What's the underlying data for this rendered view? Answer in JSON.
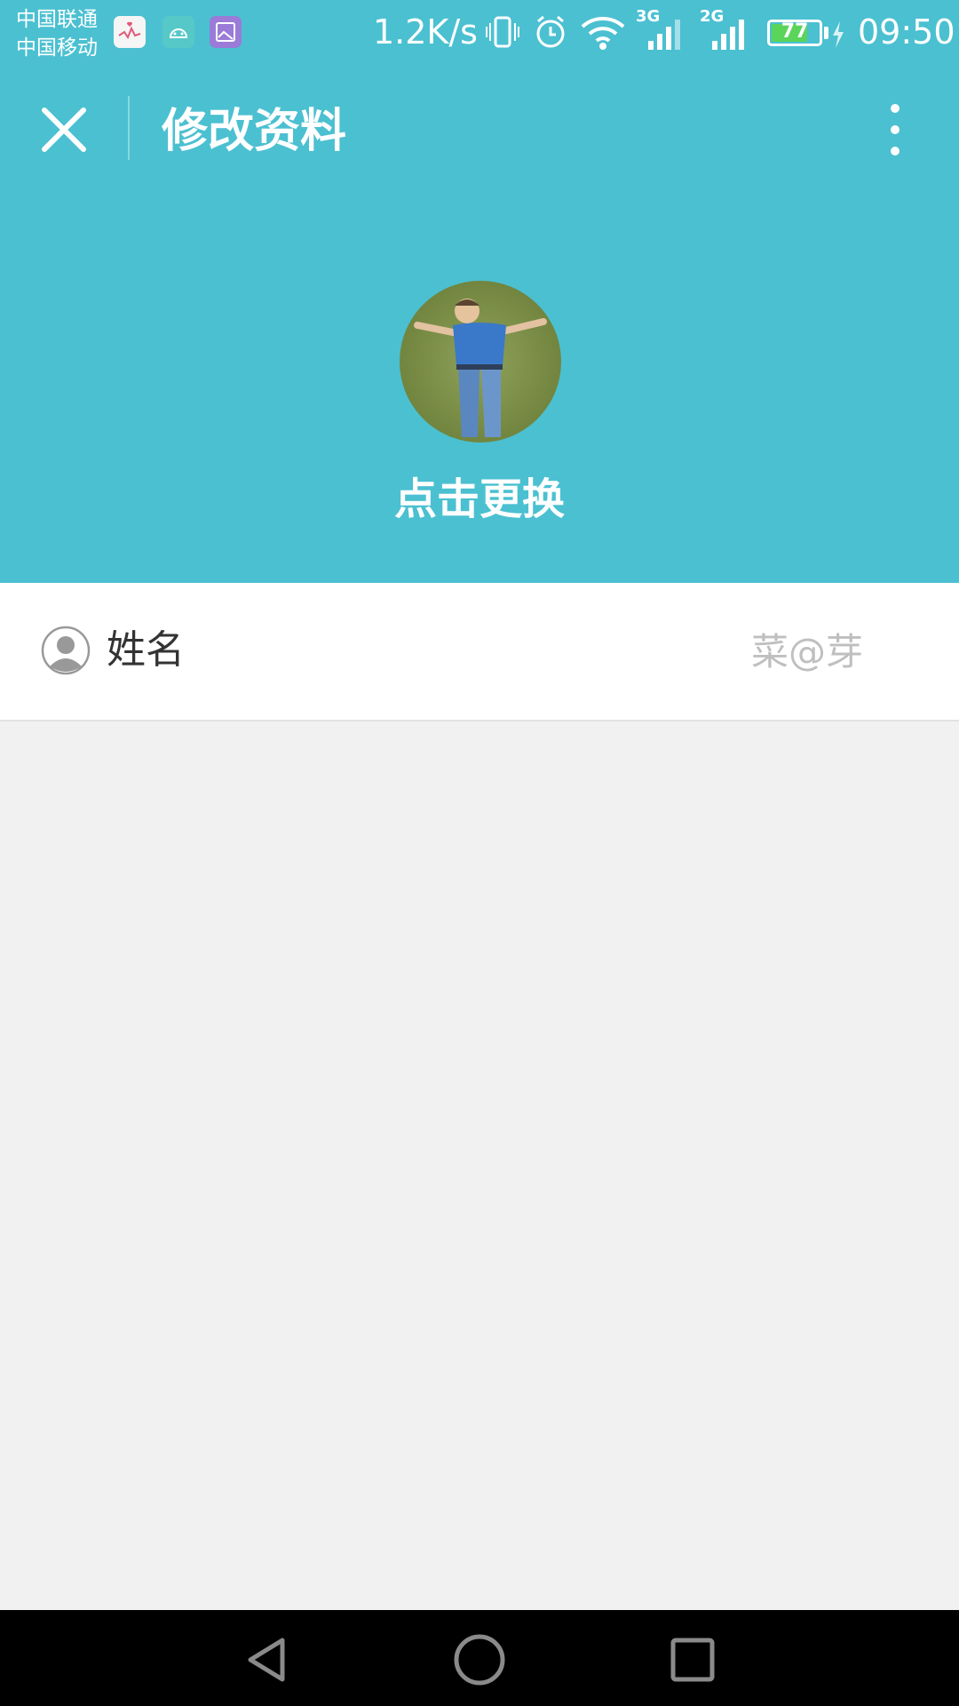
{
  "status_bar": {
    "carrier1": "中国联通",
    "carrier2": "中国移动",
    "net_speed": "1.2K/s",
    "sig1_label": "3G",
    "sig2_label": "2G",
    "battery": "77",
    "battery_level": 0.77,
    "time": "09:50"
  },
  "header": {
    "title": "修改资料",
    "change_avatar_label": "点击更换"
  },
  "profile": {
    "name_label": "姓名",
    "name_value": "菜@芽"
  },
  "colors": {
    "accent": "#4bc0d1",
    "background": "#f1f1f1"
  },
  "icons": [
    "close-icon",
    "more-vert-icon",
    "user-icon",
    "back-icon",
    "home-icon",
    "recents-icon"
  ]
}
